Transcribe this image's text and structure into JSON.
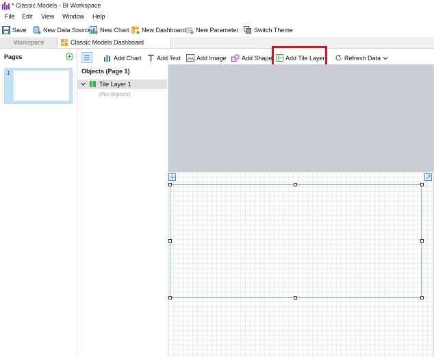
{
  "window": {
    "title": "* Classic Models - BI Workspace",
    "app_icon": "bar-chart-icon"
  },
  "menu": [
    "File",
    "Edit",
    "View",
    "Window",
    "Help"
  ],
  "toolbar": {
    "save": "Save",
    "new_data_source": "New Data Source",
    "new_chart": "New Chart",
    "new_dashboard": "New Dashboard",
    "new_parameter": "New Parameter",
    "switch_theme": "Switch Theme"
  },
  "tabs": [
    {
      "label": "Workspace",
      "active": false
    },
    {
      "label": "Classic Models Dashboard",
      "active": true
    }
  ],
  "pages_panel": {
    "title": "Pages",
    "pages": [
      {
        "number": "1"
      }
    ]
  },
  "objects_panel": {
    "title": "Objects (Page 1)",
    "items": [
      {
        "label": "Tile Layer 1"
      }
    ],
    "empty_text": "(No objects)"
  },
  "design_toolbar": {
    "add_chart": "Add Chart",
    "add_text": "Add Text",
    "add_image": "Add Image",
    "add_shape": "Add Shape",
    "add_tile_layer": "Add Tile Layer",
    "refresh_data": "Refresh Data"
  },
  "colors": {
    "highlight": "#e0131d",
    "selected_page": "#bfe0f7",
    "canvas_top": "#c8ccd4",
    "tile_border": "#87b9a6"
  }
}
